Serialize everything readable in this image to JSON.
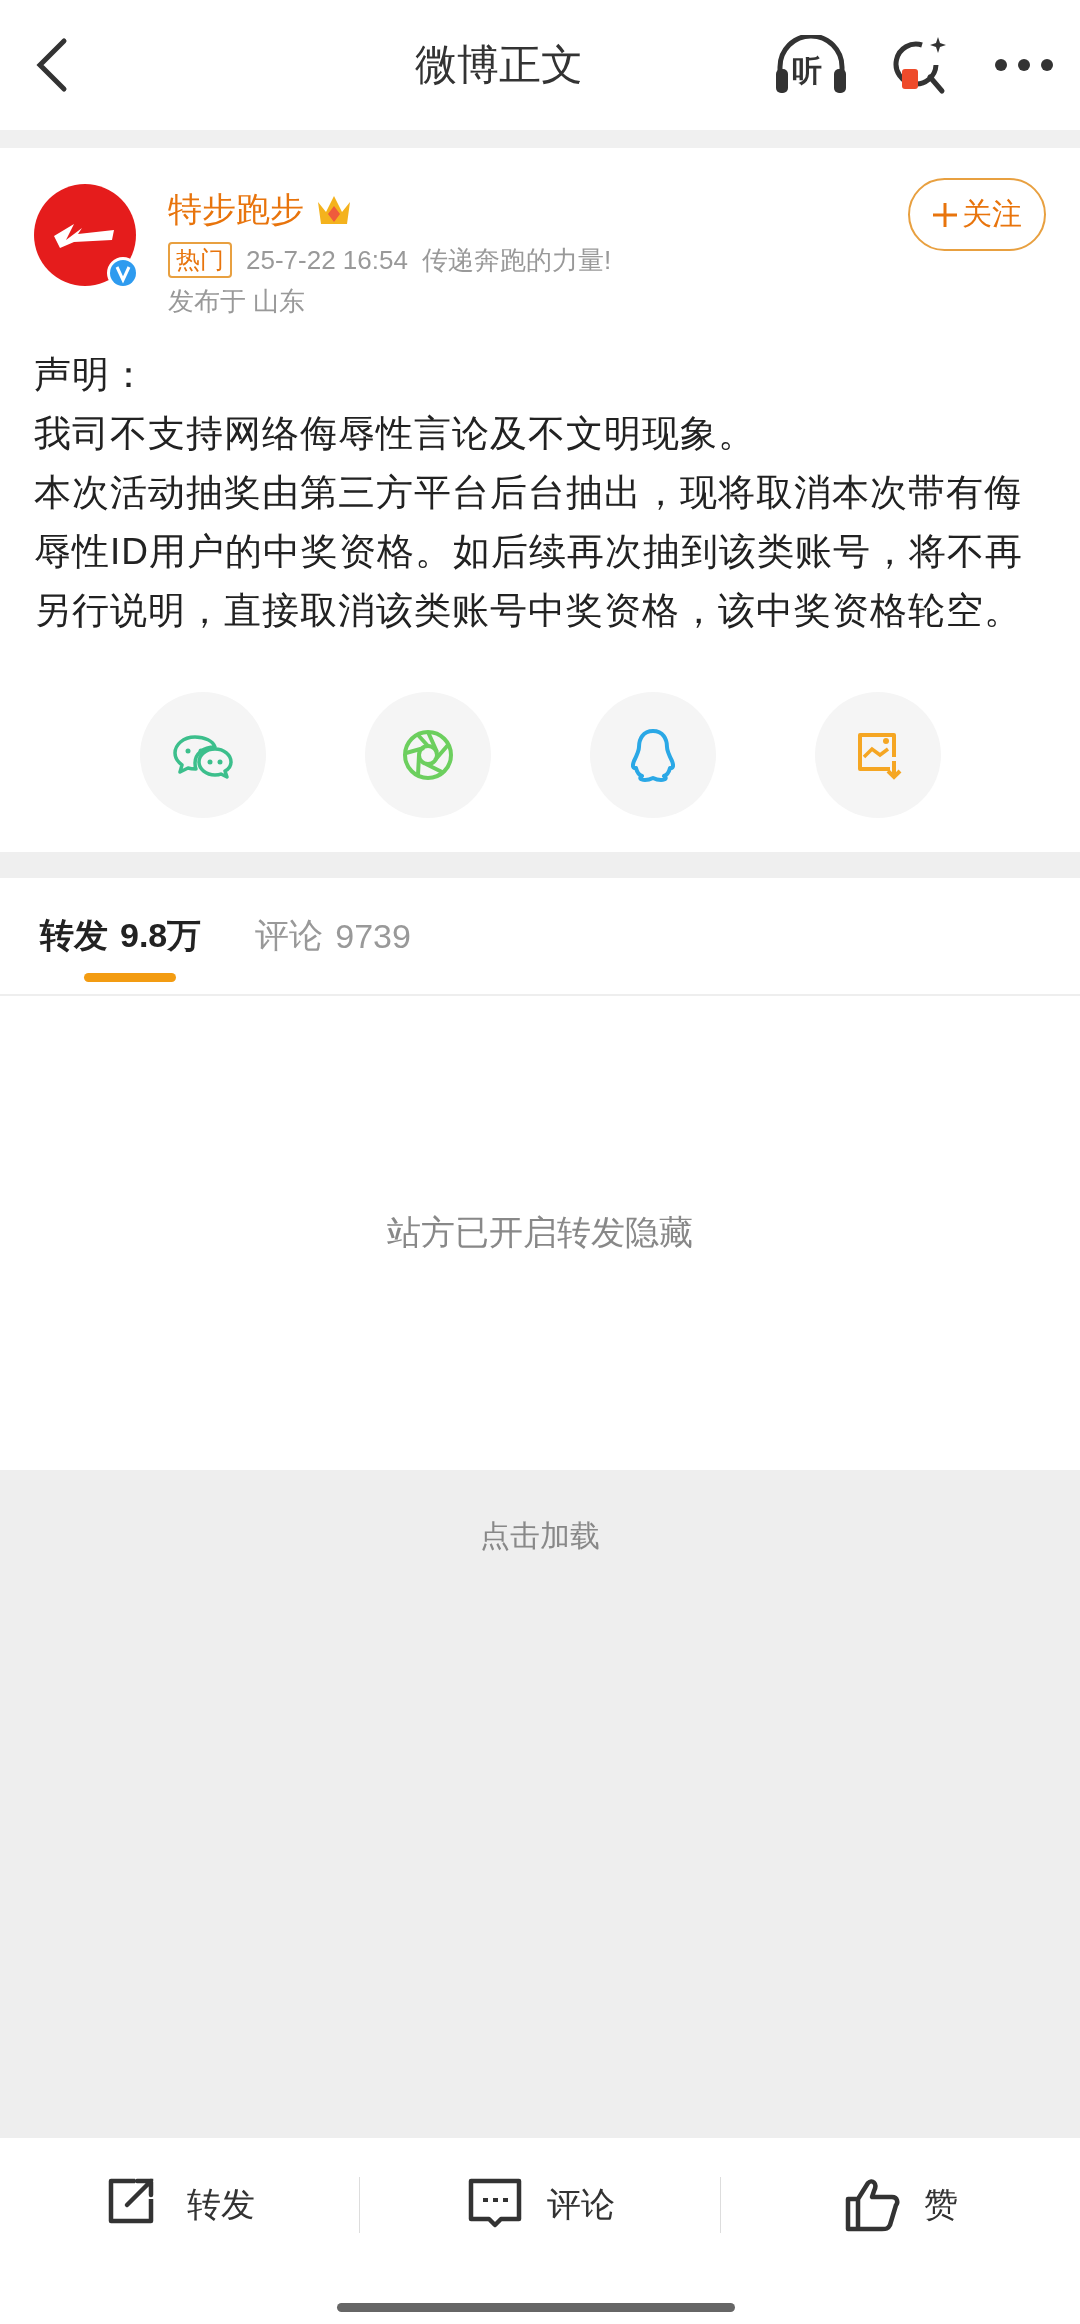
{
  "nav": {
    "title": "微博正文",
    "listen_label": "听"
  },
  "post": {
    "author": "特步跑步",
    "verified": true,
    "follow_button": "关注",
    "badge": "热门",
    "time": "25-7-22 16:54",
    "source": "传递奔跑的力量!",
    "location": "发布于 山东",
    "body": [
      "声明：",
      "我司不支持网络侮辱性言论及不文明现象。",
      "本次活动抽奖由第三方平台后台抽出，现将取消本次带有侮辱性ID用户的中奖资格。如后续再次抽到该类账号，将不再另行说明，直接取消该类账号中奖资格，该中奖资格轮空。"
    ]
  },
  "share": [
    {
      "kind": "wechat"
    },
    {
      "kind": "moments"
    },
    {
      "kind": "qq"
    },
    {
      "kind": "save-image"
    }
  ],
  "tabs": [
    {
      "label": "转发",
      "count": "9.8万",
      "selected": true
    },
    {
      "label": "评论",
      "count": "9739",
      "selected": false
    }
  ],
  "empty_message": "站方已开启转发隐藏",
  "load_more": "点击加载",
  "actions": [
    {
      "kind": "repost",
      "label": "转发"
    },
    {
      "kind": "comment",
      "label": "评论"
    },
    {
      "kind": "like",
      "label": "赞"
    }
  ]
}
